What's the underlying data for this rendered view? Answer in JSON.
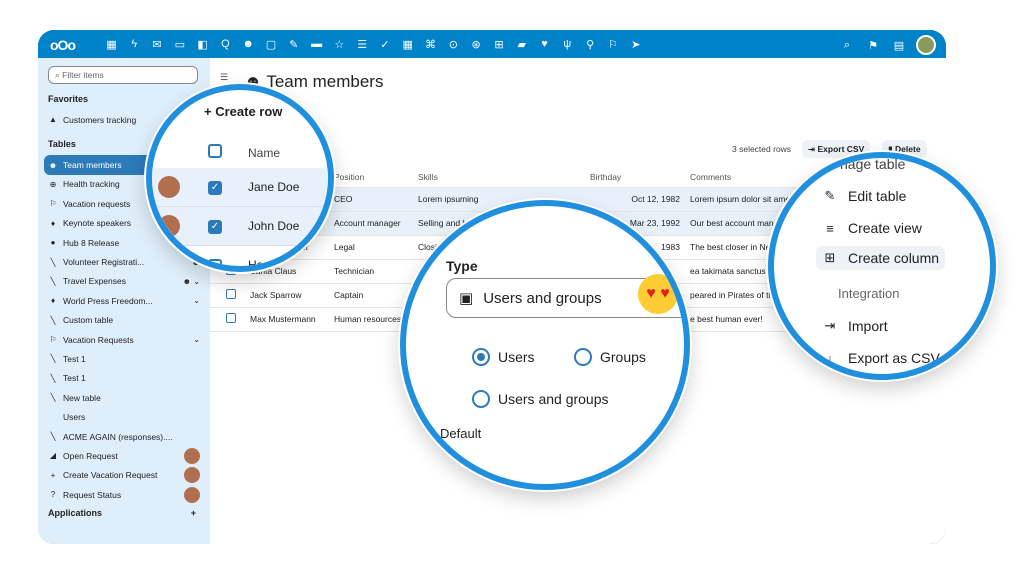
{
  "topbar": {
    "logo": "oOo",
    "apps": [
      "▦",
      "ϟ",
      "✉",
      "▭",
      "◧",
      "Q",
      "☻",
      "▢",
      "✎",
      "▬",
      "☆",
      "☰",
      "✓",
      "▦",
      "⌘",
      "⊙",
      "⊛",
      "⊞",
      "▰",
      "♥",
      "ψ",
      "⚲",
      "⚐",
      "➤"
    ],
    "right": [
      "⌕",
      "⚑",
      "▤"
    ]
  },
  "sidebar": {
    "filter_placeholder": "Filter items",
    "favorites_head": "Favorites",
    "favorites": [
      {
        "icon": "▲",
        "label": "Customers tracking"
      }
    ],
    "tables_head": "Tables",
    "tables": [
      {
        "icon": "☻",
        "label": "Team members",
        "active": true
      },
      {
        "icon": "⊕",
        "label": "Health tracking"
      },
      {
        "icon": "⚐",
        "label": "Vacation requests"
      },
      {
        "icon": "♦",
        "label": "Keynote speakers"
      },
      {
        "icon": "●",
        "label": "Hub 8 Release"
      },
      {
        "icon": "╲",
        "label": "Volunteer Registrati...",
        "right": "☻"
      },
      {
        "icon": "╲",
        "label": "Travel Expenses",
        "right": "☻ ⌄"
      },
      {
        "icon": "♦",
        "label": "World Press Freedom...",
        "right": "⌄"
      },
      {
        "icon": "╲",
        "label": "Custom table"
      },
      {
        "icon": "⚐",
        "label": "Vacation Requests",
        "right": "⌄"
      },
      {
        "icon": "╲",
        "label": "Test 1"
      },
      {
        "icon": "╲",
        "label": "Test 1"
      },
      {
        "icon": "╲",
        "label": "New table"
      },
      {
        "icon": " ",
        "label": "Users"
      },
      {
        "icon": "╲",
        "label": "ACME AGAIN (responses)...."
      },
      {
        "icon": "◢",
        "label": "Open Request",
        "avatar": true
      },
      {
        "icon": "+",
        "label": "Create Vacation Request",
        "avatar": true
      },
      {
        "icon": "?",
        "label": "Request Status",
        "avatar": true
      }
    ],
    "applications_head": "Applications",
    "applications_add": "+"
  },
  "main": {
    "title": "Team members",
    "selected_info": "3 selected rows",
    "export_csv": "Export CSV",
    "delete": "Delete",
    "headers": [
      "Name",
      "Position",
      "Skills",
      "Birthday",
      "Comments"
    ],
    "rows": [
      {
        "sel": true,
        "name": "Jane Doe",
        "position": "CEO",
        "skills": "Lorem ipsuming",
        "birthday": "Oct 12, 1982",
        "comment": "Lorem ipsum dolor sit amet, consetetur"
      },
      {
        "sel": true,
        "name": "John Doe",
        "position": "Account manager",
        "skills": "Selling and buying",
        "birthday": "Mar 23, 1992",
        "comment": "Our best account manager"
      },
      {
        "sel": false,
        "name": "Harvey Specter",
        "position": "Legal",
        "skills": "Closing",
        "birthday": "1983",
        "comment": "The best closer in New York"
      },
      {
        "sel": false,
        "name": "Santa Claus",
        "position": "Technician",
        "skills": "",
        "birthday": "",
        "comment": "ea takimata sanctus est"
      },
      {
        "sel": false,
        "name": "Jack Sparrow",
        "position": "Captain",
        "skills": "",
        "birthday": "",
        "comment": "peared in Pirates of the Car"
      },
      {
        "sel": false,
        "name": "Max Mustermann",
        "position": "Human resources",
        "skills": "",
        "birthday": "",
        "comment": "e best human ever!"
      }
    ]
  },
  "lens1": {
    "create_row": "+ Create row",
    "name_header": "Name",
    "rows": [
      "Jane Doe",
      "John Doe",
      "Harvey Specter",
      "Santa Claus"
    ]
  },
  "lens2": {
    "type_label": "Type",
    "select_value": "Users and groups",
    "emoji": "♥ ♥",
    "radio_users": "Users",
    "radio_groups": "Groups",
    "radio_both": "Users and groups",
    "default_label": "Default"
  },
  "lens3": {
    "cut_title": "nage table",
    "edit_table": "Edit table",
    "create_view": "Create view",
    "create_column": "Create column",
    "integration": "Integration",
    "import": "Import",
    "export_csv": "Export as CSV"
  }
}
